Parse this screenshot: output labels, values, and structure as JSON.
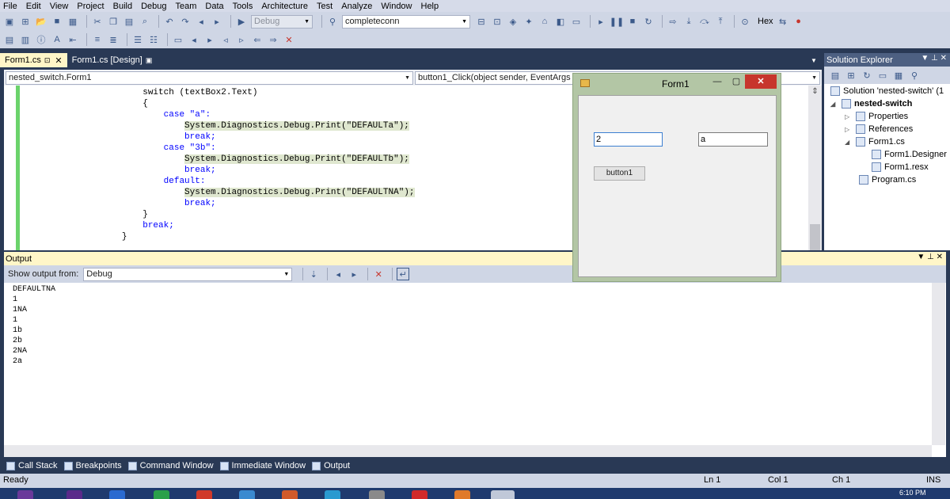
{
  "menu": [
    "File",
    "Edit",
    "View",
    "Project",
    "Build",
    "Debug",
    "Team",
    "Data",
    "Tools",
    "Architecture",
    "Test",
    "Analyze",
    "Window",
    "Help"
  ],
  "toolbar": {
    "config_value": "Debug",
    "find_value": "completeconn",
    "hex_label": "Hex"
  },
  "doc_tabs": [
    {
      "label": "Form1.cs",
      "active": true
    },
    {
      "label": "Form1.cs [Design]",
      "active": false
    }
  ],
  "navbar": {
    "class_value": "nested_switch.Form1",
    "member_value": "button1_Click(object sender, EventArgs"
  },
  "code_lines": [
    "switch (textBox2.Text)",
    "{",
    "case \"a\":",
    "System.Diagnostics.Debug.Print(\"DEFAULTa\");",
    "break;",
    "case \"3b\":",
    "System.Diagnostics.Debug.Print(\"DEFAULTb\");",
    "break;",
    "default:",
    "System.Diagnostics.Debug.Print(\"DEFAULTNA\");",
    "break;",
    "}",
    "break;",
    "}"
  ],
  "form1": {
    "title": "Form1",
    "textbox1_value": "2",
    "textbox2_value": "a",
    "button_label": "button1"
  },
  "solution_explorer": {
    "title": "Solution Explorer",
    "items": [
      {
        "label": "Solution 'nested-switch' (1"
      },
      {
        "label": "nested-switch"
      },
      {
        "label": "Properties"
      },
      {
        "label": "References"
      },
      {
        "label": "Form1.cs"
      },
      {
        "label": "Form1.Designer"
      },
      {
        "label": "Form1.resx"
      },
      {
        "label": "Program.cs"
      }
    ]
  },
  "output": {
    "title": "Output",
    "show_from_label": "Show output from:",
    "source_value": "Debug",
    "lines": [
      "DEFAULTNA",
      "1",
      "1NA",
      "1",
      "1b",
      "2b",
      "2NA",
      "2a"
    ]
  },
  "bottom_tabs": [
    "Call Stack",
    "Breakpoints",
    "Command Window",
    "Immediate Window",
    "Output"
  ],
  "status": {
    "left": "Ready",
    "ln": "Ln 1",
    "col": "Col 1",
    "ch": "Ch 1",
    "mode": "INS"
  },
  "taskbar": {
    "clock": "6:10 PM"
  },
  "colors": {
    "chrome_dark": "#293955",
    "active_tab": "#fff6c8",
    "form_close": "#c7352c",
    "change_bar": "#6bd36b"
  }
}
